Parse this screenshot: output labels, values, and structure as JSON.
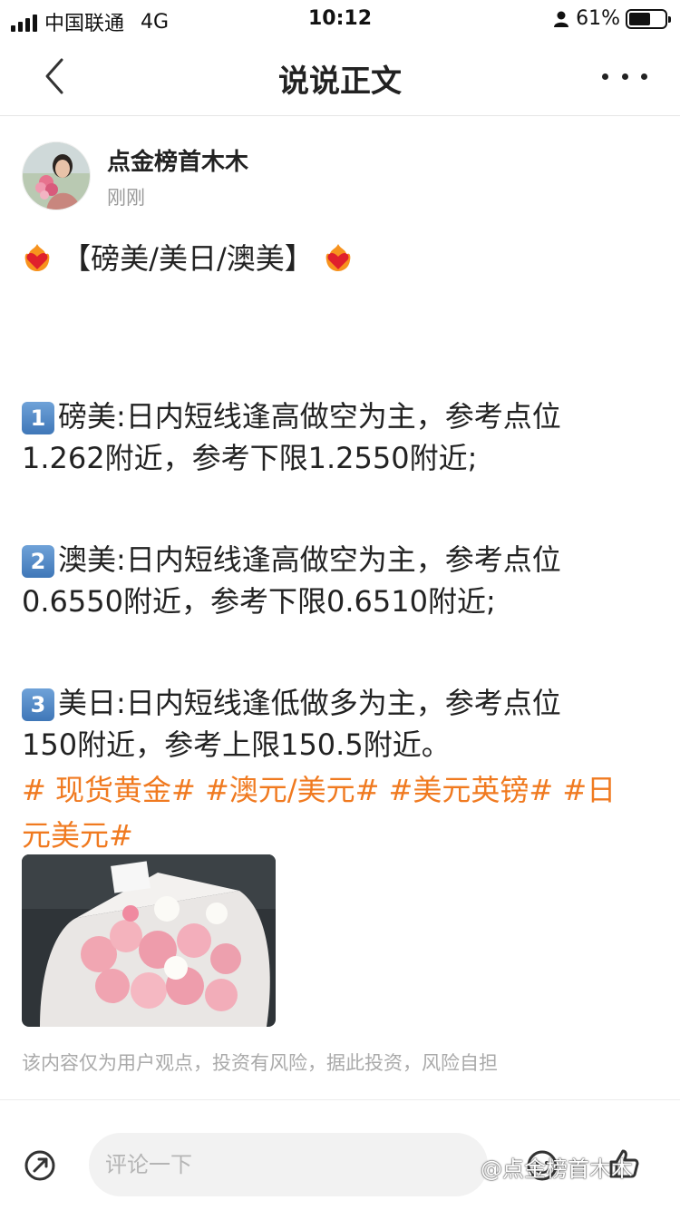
{
  "status_bar": {
    "carrier": "中国联通",
    "network": "4G",
    "time": "10:12",
    "battery": "61%",
    "battery_level": 0.61
  },
  "nav": {
    "title": "说说正文"
  },
  "author": {
    "name": "点金榜首木木",
    "time": "刚刚"
  },
  "post": {
    "heading": "【磅美/美日/澳美】",
    "items": [
      {
        "badge": "1",
        "line1": "磅美:日内短线逢高做空为主，参考点位",
        "line2": "1.262附近，参考下限1.2550附近;"
      },
      {
        "badge": "2",
        "line1": "澳美:日内短线逢高做空为主，参考点位",
        "line2": "0.6550附近，参考下限0.6510附近;"
      },
      {
        "badge": "3",
        "line1": "美日:日内短线逢低做多为主，参考点位",
        "line2": "150附近，参考上限150.5附近。"
      }
    ],
    "tags_line1": "# 现货黄金# #澳元/美元# #美元英镑# #日",
    "tags_line2": "元美元#",
    "disclaimer": "该内容仅为用户观点，投资有风险，据此投资，风险自担"
  },
  "bottom": {
    "comment_placeholder": "评论一下",
    "watermark": "@点金榜首木木"
  },
  "colors": {
    "tag": "#f07a20",
    "badge": "#3f77b8"
  }
}
